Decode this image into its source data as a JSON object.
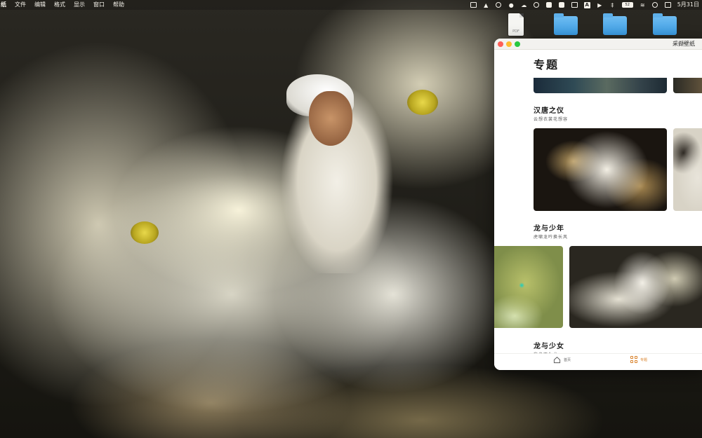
{
  "menubar": {
    "app_name": "纸",
    "items": [
      "文件",
      "编辑",
      "格式",
      "显示",
      "窗口",
      "帮助"
    ],
    "status_icons": [
      "sidebar-icon",
      "cat-icon",
      "search-magnify-icon",
      "wechat-icon",
      "cloud-icon",
      "play-circle-icon",
      "document-icon",
      "clipboard-icon",
      "text-box-icon",
      "input-a-icon",
      "volume-icon",
      "bluetooth-icon",
      "battery-icon",
      "wifi-icon",
      "spotlight-icon",
      "control-center-icon"
    ],
    "battery_text": "52",
    "input_letter": "A",
    "clock": "5月31日"
  },
  "desktop": {
    "pdf_label": "PDF",
    "folders": 3
  },
  "window": {
    "title": "采撷壁纸",
    "page_title": "专题",
    "sections": [
      {
        "title": "汉唐之仪",
        "subtitle": "云想衣裳花想容"
      },
      {
        "title": "龙与少年",
        "subtitle": "虎啸龙吟换长风"
      },
      {
        "title": "龙与少女",
        "subtitle": "我名不为龙"
      }
    ],
    "tabs": [
      {
        "label": "首页",
        "icon": "home-icon"
      },
      {
        "label": "专题",
        "icon": "grid-icon"
      }
    ]
  },
  "colors": {
    "accent": "#d9822b",
    "folder": "#3a9be2",
    "close": "#fe5f57",
    "minimize": "#febc2e",
    "maximize": "#28c840"
  }
}
